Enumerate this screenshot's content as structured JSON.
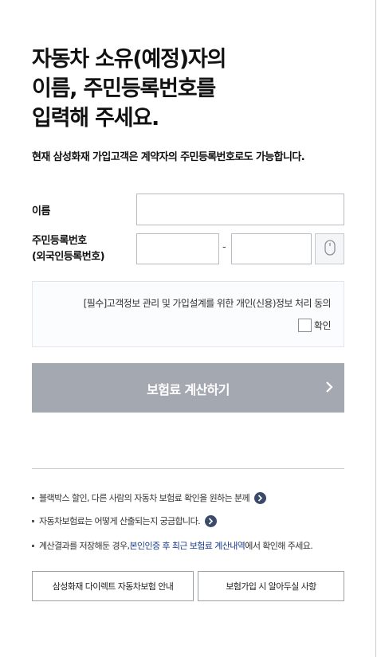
{
  "heading": {
    "line1": "자동차 소유(예정)자의",
    "line2": "이름, 주민등록번호를",
    "line3": "입력해 주세요."
  },
  "subtitle": "현재 삼성화재 가입고객은 계약자의 주민등록번호로도 가능합니다.",
  "form": {
    "name_label": "이름",
    "name_value": "",
    "rrn_label_line1": "주민등록번호",
    "rrn_label_line2": "(외국인등록번호)",
    "rrn_front_value": "",
    "rrn_back_value": "",
    "separator": "-",
    "keypad_icon": "mouse-keypad-icon"
  },
  "consent": {
    "text": "[필수]고객정보 관리 및 가입설계를 위한 개인(신용)정보 처리 동의",
    "checkbox_label": "확인",
    "checked": false
  },
  "primary_button": {
    "label": "보험료 계산하기",
    "icon": "chevron-right-icon",
    "disabled_color": "#a4a8b0"
  },
  "info_links": {
    "item1": "블랙박스 할인, 다른 사람의 자동차 보험료 확인을 원하는 분께",
    "item2": "자동차보험료는 어떻게 산출되는지 궁금합니다.",
    "item3_prefix": "계산결과를 저장해둔 경우, ",
    "item3_highlight": "본인인증 후 최근 보험료 계산내역",
    "item3_suffix": "에서 확인해 주세요.",
    "arrow_icon": "circle-arrow-right-icon",
    "arrow_color": "#3a4a6b",
    "highlight_color": "#1a3a8a"
  },
  "bottom_buttons": {
    "left": "삼성화재 다이렉트 자동차보험 안내",
    "right": "보험가입 시 알아두실 사항"
  }
}
